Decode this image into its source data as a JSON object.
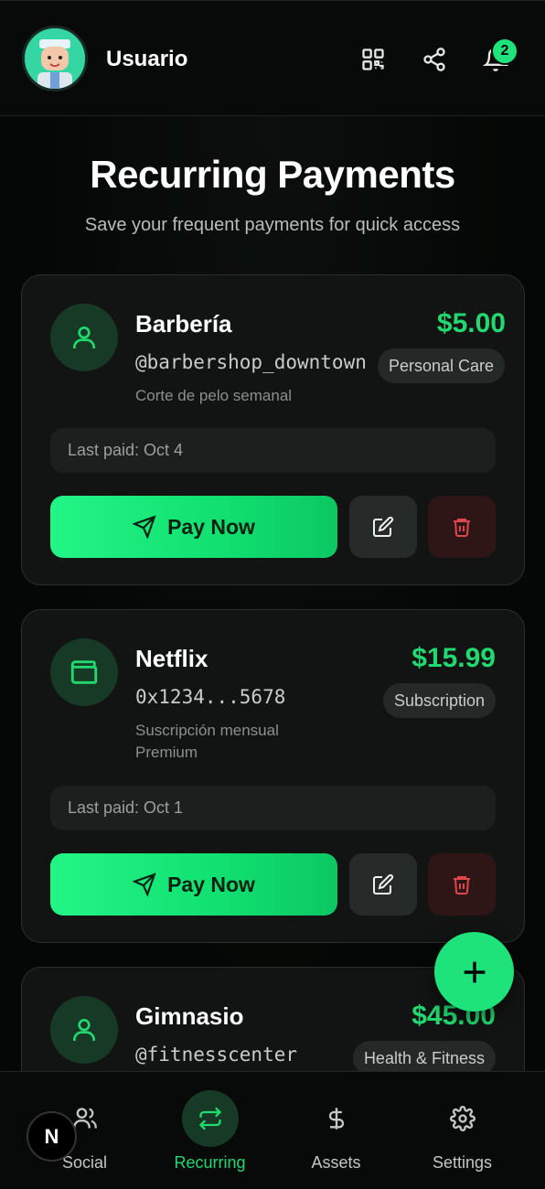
{
  "header": {
    "username": "Usuario",
    "notification_count": "2"
  },
  "page": {
    "title": "Recurring Payments",
    "subtitle": "Save your frequent payments for quick access"
  },
  "cards": [
    {
      "icon": "user-icon",
      "name": "Barbería",
      "handle": "@barbershop_downtown",
      "description": "Corte de pelo semanal",
      "amount": "$5.00",
      "category": "Personal Care",
      "last_paid": "Last paid: Oct 4",
      "pay_label": "Pay Now"
    },
    {
      "icon": "wallet-icon",
      "name": "Netflix",
      "handle": "0x1234...5678",
      "description": "Suscripción mensual Premium",
      "amount": "$15.99",
      "category": "Subscription",
      "last_paid": "Last paid: Oct 1",
      "pay_label": "Pay Now"
    },
    {
      "icon": "user-icon",
      "name": "Gimnasio",
      "handle": "@fitnesscenter",
      "amount": "$45.00",
      "category": "Health & Fitness"
    }
  ],
  "nav": {
    "items": [
      {
        "label": "Social",
        "icon": "users-icon"
      },
      {
        "label": "Recurring",
        "icon": "repeat-icon",
        "active": true
      },
      {
        "label": "Assets",
        "icon": "dollar-icon"
      },
      {
        "label": "Settings",
        "icon": "gear-icon"
      }
    ]
  },
  "floating_badge": "N",
  "colors": {
    "accent": "#22d96f",
    "background": "#050706",
    "card": "#111413",
    "danger": "#e0464a"
  }
}
